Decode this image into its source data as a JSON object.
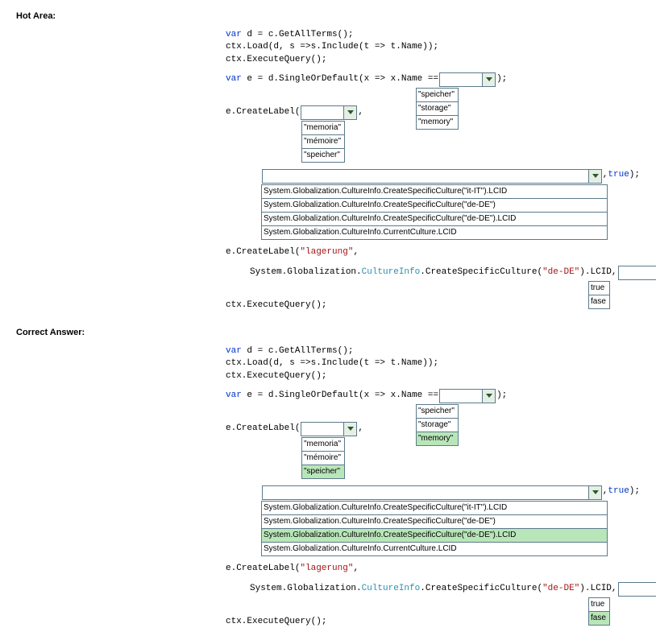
{
  "labels": {
    "hotArea": "Hot Area:",
    "correctAnswer": "Correct Answer:"
  },
  "code": {
    "l1a": "var",
    "l1b": " d = c.GetAllTerms();",
    "l2": "ctx.Load(d, s =>s.Include(t => t.Name));",
    "l3": "ctx.ExecuteQuery();",
    "l4a": "var",
    "l4b": " e = d.SingleOrDefault(x => x.Name ==",
    "l4c": ");",
    "l5a": "e.CreateLabel(",
    "l5b": ",",
    "l6a": ", ",
    "l6b": "true",
    "l6c": ");",
    "l7a": "e.CreateLabel(",
    "l7b": "\"lagerung\"",
    "l7c": ",",
    "l8a": "System.Globalization.",
    "l8b": "CultureInfo",
    "l8c": ".CreateSpecificCulture(",
    "l8d": "\"de-DE\"",
    "l8e": ").LCID,",
    "l8f": ");",
    "l9": "ctx.ExecuteQuery();"
  },
  "dd1_opts": [
    "\"speicher\"",
    "\"storage\"",
    "\"memory\""
  ],
  "dd2_opts": [
    "\"memoria\"",
    "\"mémoire\"",
    "\"speicher\""
  ],
  "dd3_opts": [
    "System.Globalization.CultureInfo.CreateSpecificCulture(\"it-IT\").LCID",
    "System.Globalization.CultureInfo.CreateSpecificCulture(\"de-DE\")",
    "System.Globalization.CultureInfo.CreateSpecificCulture(\"de-DE\").LCID",
    "System.Globalization.CultureInfo.CurrentCulture.LCID"
  ],
  "dd4_opts": [
    "true",
    "fase"
  ],
  "answers": {
    "dd1": 2,
    "dd2": 2,
    "dd3": 2,
    "dd4": 1
  }
}
